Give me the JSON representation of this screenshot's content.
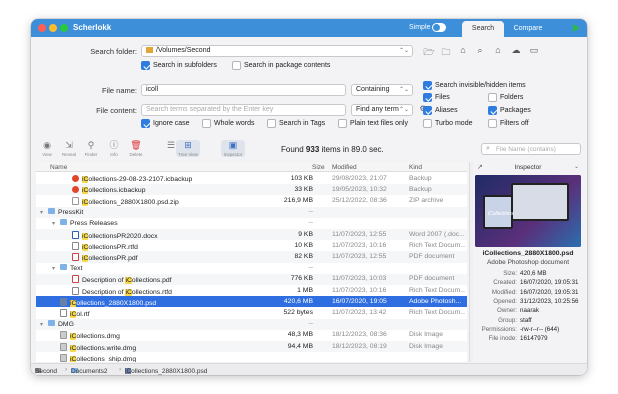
{
  "window": {
    "app_title": "Scherlokk",
    "simple_label": "Simple",
    "tabs": [
      {
        "label": "Search",
        "active": true
      },
      {
        "label": "Compare",
        "active": false
      }
    ]
  },
  "search": {
    "folder_label": "Search folder:",
    "folder_value": "/Volumes/Second",
    "in_subfolders": {
      "label": "Search in subfolders",
      "checked": true
    },
    "in_packages": {
      "label": "Search in package contents",
      "checked": false
    },
    "file_name_label": "File name:",
    "file_name_value": "icoll",
    "file_name_mode": "Containing",
    "file_content_label": "File content:",
    "file_content_placeholder": "Search terms separated by the Enter key",
    "content_mode": "Find any term",
    "invisible": {
      "label": "Search invisible/hidden items",
      "checked": true
    },
    "files": {
      "label": "Files",
      "checked": true
    },
    "folders": {
      "label": "Folders",
      "checked": false
    },
    "aliases": {
      "label": "Aliases",
      "checked": true
    },
    "packages": {
      "label": "Packages",
      "checked": true
    },
    "ignore_case": {
      "label": "Ignore case",
      "checked": true
    },
    "whole_words": {
      "label": "Whole words",
      "checked": false
    },
    "in_tags": {
      "label": "Search in Tags",
      "checked": false
    },
    "plain_text": {
      "label": "Plain text files only",
      "checked": false
    },
    "turbo": {
      "label": "Turbo mode",
      "checked": false
    },
    "filters_off": {
      "label": "Filters off",
      "checked": false
    }
  },
  "toolbar": {
    "buttons": [
      {
        "label": "View",
        "icon": "eye-icon"
      },
      {
        "label": "Reveal",
        "icon": "reveal-icon"
      },
      {
        "label": "Finder",
        "icon": "finder-icon"
      },
      {
        "label": "Info",
        "icon": "info-icon"
      },
      {
        "label": "Delete",
        "icon": "trash-icon"
      },
      {
        "label": "",
        "icon": "list-view-icon"
      },
      {
        "label": "Tree View",
        "icon": "tree-view-icon"
      },
      {
        "label": "Inspector",
        "icon": "inspector-icon"
      }
    ],
    "found_prefix": "Found",
    "found_count": "933",
    "found_suffix": "items in 89.0 sec.",
    "filter_placeholder": "File Name (contains)"
  },
  "list": {
    "columns": {
      "name": "Name",
      "size": "Size",
      "modified": "Modified",
      "kind": "Kind"
    },
    "rows": [
      {
        "indent": 2,
        "disc": "",
        "icon": "red",
        "pre": "",
        "hl": "iC",
        "post": "ollections-29-08-23-2107.icbackup",
        "size": "103 KB",
        "modified": "29/08/2023, 21:07",
        "kind": "Backup",
        "selected": false
      },
      {
        "indent": 2,
        "disc": "",
        "icon": "red",
        "pre": "",
        "hl": "iC",
        "post": "ollections.icbackup",
        "size": "33 KB",
        "modified": "19/05/2023, 10:32",
        "kind": "Backup",
        "selected": false
      },
      {
        "indent": 2,
        "disc": "",
        "icon": "doc",
        "pre": "",
        "hl": "iC",
        "post": "ollections_2880X1800.psd.zip",
        "size": "216,9 MB",
        "modified": "25/12/2022, 08:36",
        "kind": "ZIP archive",
        "selected": false
      },
      {
        "indent": 0,
        "disc": "▾",
        "icon": "folder",
        "pre": "PressKit",
        "hl": "",
        "post": "",
        "size": "--",
        "modified": "",
        "kind": "",
        "selected": false
      },
      {
        "indent": 1,
        "disc": "▾",
        "icon": "folder",
        "pre": "Press Releases",
        "hl": "",
        "post": "",
        "size": "--",
        "modified": "",
        "kind": "",
        "selected": false
      },
      {
        "indent": 2,
        "disc": "",
        "icon": "word",
        "pre": "",
        "hl": "iC",
        "post": "ollectionsPR2020.docx",
        "size": "9 KB",
        "modified": "11/07/2023, 12:55",
        "kind": "Word 2007 (.doc...",
        "selected": false
      },
      {
        "indent": 2,
        "disc": "",
        "icon": "rtf",
        "pre": "",
        "hl": "iC",
        "post": "ollectionsPR.rtfd",
        "size": "10 KB",
        "modified": "11/07/2023, 10:16",
        "kind": "Rich Text Docum...",
        "selected": false
      },
      {
        "indent": 2,
        "disc": "",
        "icon": "pdf",
        "pre": "",
        "hl": "iC",
        "post": "ollectionsPR.pdf",
        "size": "82 KB",
        "modified": "11/07/2023, 12:55",
        "kind": "PDF document",
        "selected": false
      },
      {
        "indent": 1,
        "disc": "▾",
        "icon": "folder",
        "pre": "Text",
        "hl": "",
        "post": "",
        "size": "--",
        "modified": "",
        "kind": "",
        "selected": false
      },
      {
        "indent": 2,
        "disc": "",
        "icon": "pdf",
        "pre": "Description of ",
        "hl": "iC",
        "post": "ollections.pdf",
        "size": "776 KB",
        "modified": "11/07/2023, 10:03",
        "kind": "PDF document",
        "selected": false
      },
      {
        "indent": 2,
        "disc": "",
        "icon": "rtf",
        "pre": "Description of ",
        "hl": "iC",
        "post": "ollections.rtfd",
        "size": "1 MB",
        "modified": "11/07/2023, 10:16",
        "kind": "Rich Text Docum...",
        "selected": false
      },
      {
        "indent": 1,
        "disc": "",
        "icon": "img",
        "pre": "",
        "hl": "iC",
        "post": "ollections_2880X1800.psd",
        "size": "420,6 MB",
        "modified": "16/07/2020, 19:05",
        "kind": "Adobe Photosh...",
        "selected": true
      },
      {
        "indent": 1,
        "disc": "",
        "icon": "rtf",
        "pre": "",
        "hl": "iC",
        "post": "ol.rtf",
        "size": "522 bytes",
        "modified": "11/07/2023, 13:42",
        "kind": "Rich Text Docum...",
        "selected": false
      },
      {
        "indent": 0,
        "disc": "▾",
        "icon": "folder",
        "pre": "DMG",
        "hl": "",
        "post": "",
        "size": "--",
        "modified": "",
        "kind": "",
        "selected": false
      },
      {
        "indent": 1,
        "disc": "",
        "icon": "dmg",
        "pre": "",
        "hl": "iC",
        "post": "ollections.dmg",
        "size": "48,3 MB",
        "modified": "18/12/2023, 08:36",
        "kind": "Disk Image",
        "selected": false
      },
      {
        "indent": 1,
        "disc": "",
        "icon": "dmg",
        "pre": "",
        "hl": "iC",
        "post": "ollections.write.dmg",
        "size": "94,4 MB",
        "modified": "18/12/2023, 08:19",
        "kind": "Disk Image",
        "selected": false
      },
      {
        "indent": 1,
        "disc": "",
        "icon": "dmg",
        "pre": "",
        "hl": "iC",
        "post": "ollections_ship.dmg",
        "size": "",
        "modified": "",
        "kind": "",
        "selected": false
      }
    ]
  },
  "inspector": {
    "title": "Inspector",
    "preview_text": "iCollections",
    "file_name": "iCollections_2880X1800.psd",
    "file_kind": "Adobe Photoshop document",
    "fields": [
      {
        "key": "Size:",
        "value": "420,6 MB"
      },
      {
        "key": "Created:",
        "value": "16/07/2020, 19:05:31"
      },
      {
        "key": "Modified:",
        "value": "16/07/2020, 19:05:31"
      },
      {
        "key": "Opened:",
        "value": "31/12/2023, 10:25:56"
      },
      {
        "key": "Owner:",
        "value": "naarak"
      },
      {
        "key": "Group:",
        "value": "staff"
      },
      {
        "key": "Permissions:",
        "value": "-rw-r--r-- (644)"
      },
      {
        "key": "File inode:",
        "value": "16147979"
      }
    ]
  },
  "pathbar": {
    "items": [
      "Second",
      "Documents2",
      "iCollections_2880X1800.psd"
    ]
  }
}
